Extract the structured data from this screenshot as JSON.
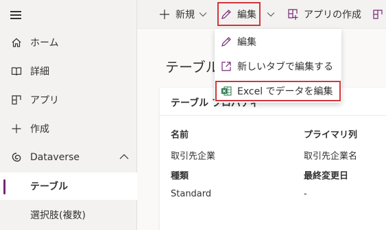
{
  "sidebar": {
    "items": [
      {
        "label": "ホーム",
        "icon": "home-icon"
      },
      {
        "label": "詳細",
        "icon": "book-icon"
      },
      {
        "label": "アプリ",
        "icon": "apps-icon"
      },
      {
        "label": "作成",
        "icon": "plus-icon"
      },
      {
        "label": "Dataverse",
        "icon": "dataverse-icon"
      },
      {
        "label": "テーブル",
        "selected": true
      },
      {
        "label": "選択肢(複数)"
      }
    ]
  },
  "toolbar": {
    "new_label": "新規",
    "edit_label": "編集",
    "create_app_label": "アプリの作成"
  },
  "edit_menu": {
    "items": [
      {
        "label": "編集",
        "icon": "pencil-icon"
      },
      {
        "label": "新しいタブで編集する",
        "icon": "open-new-tab-icon"
      },
      {
        "label": "Excel でデータを編集",
        "icon": "excel-icon",
        "highlighted": true
      }
    ]
  },
  "main": {
    "title": "テーブル",
    "card": {
      "title": "テーブル プロパティ",
      "props": {
        "name_label": "名前",
        "name_value": "取引先企業",
        "primary_label": "プライマリ列",
        "primary_value": "取引先企業名",
        "type_label": "種類",
        "type_value": "Standard",
        "modified_label": "最終変更日",
        "modified_value": "-"
      }
    }
  },
  "colors": {
    "accent": "#742774",
    "highlight_border": "#d13438",
    "excel_green": "#217346"
  }
}
